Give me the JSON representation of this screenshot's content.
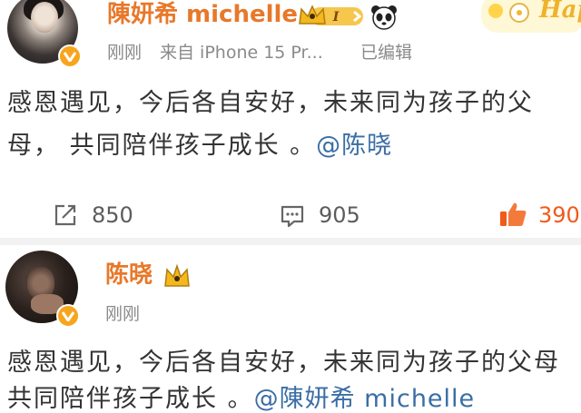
{
  "post1": {
    "author": "陳妍希 michelle",
    "level_badge": "I",
    "time": "刚刚",
    "source": "来自 iPhone 15 Pr...",
    "edited": "已编辑",
    "text_line1": "感恩遇见，今后各自安好，未来同为孩子的父",
    "text_line2_prefix": "母， 共同陪伴孩子成长 。",
    "mention": "@陈晓",
    "sticker_text": "Hap"
  },
  "actions": {
    "share_count": "850",
    "comment_count": "905",
    "like_count": "390"
  },
  "post2": {
    "author": "陈晓",
    "time": "刚刚",
    "text_line1": "感恩遇见，今后各自安好，未来同为孩子的父母",
    "text_line2_prefix": "共同陪伴孩子成长 。",
    "mention": "@陳妍希 michelle"
  },
  "colors": {
    "name": "#e8782a",
    "mention": "#3a6ea5",
    "meta": "#8a8a8a",
    "like_accent": "#f05a1a",
    "verified_badge": "#f7a51c"
  }
}
